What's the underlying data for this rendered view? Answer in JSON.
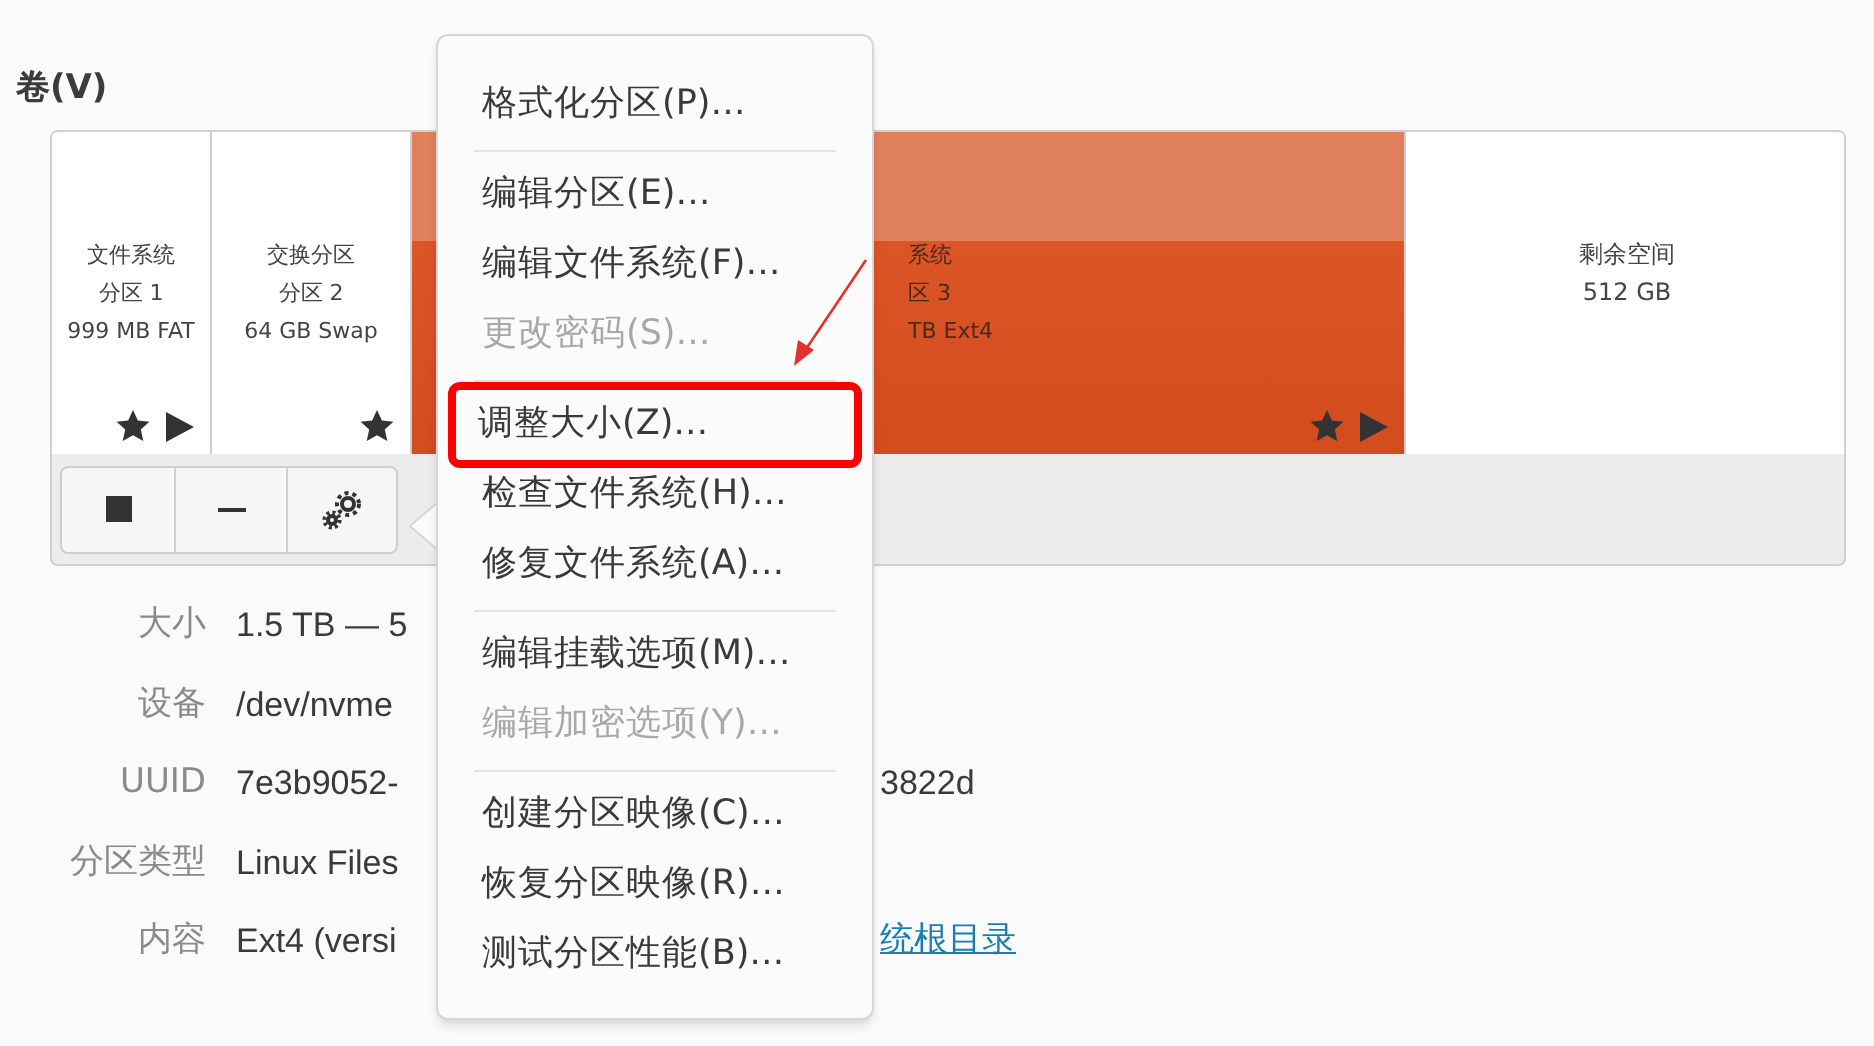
{
  "section_title": "卷(V)",
  "partitions": [
    {
      "lines": [
        "文件系统",
        "分区 1",
        "999 MB FAT"
      ],
      "kind": "used",
      "selected": false,
      "star": true,
      "play": true
    },
    {
      "lines": [
        "交换分区",
        "分区 2",
        "64 GB Swap"
      ],
      "kind": "used",
      "selected": false,
      "star": true,
      "play": false
    },
    {
      "lines": [
        "系统",
        "区 3",
        "TB Ext4"
      ],
      "kind": "used",
      "selected": true,
      "star": true,
      "play": true
    },
    {
      "lines": [
        "剩余空间",
        "512 GB"
      ],
      "kind": "free",
      "selected": false,
      "star": false,
      "play": false
    }
  ],
  "details": [
    {
      "label": "大小",
      "value": "1.5 TB — 5"
    },
    {
      "label": "设备",
      "value": "/dev/nvme"
    },
    {
      "label": "UUID",
      "value": "7e3b9052-",
      "value_tail": "3822d"
    },
    {
      "label": "分区类型",
      "value": "Linux Files"
    },
    {
      "label": "内容",
      "value": "Ext4 (versi",
      "link": "统根目录"
    }
  ],
  "menu": [
    [
      {
        "label": "格式化分区(P)…",
        "disabled": false,
        "highlighted": false
      }
    ],
    [
      {
        "label": "编辑分区(E)…",
        "disabled": false,
        "highlighted": false
      },
      {
        "label": "编辑文件系统(F)…",
        "disabled": false,
        "highlighted": false
      },
      {
        "label": "更改密码(S)…",
        "disabled": true,
        "highlighted": false
      }
    ],
    [
      {
        "label": "调整大小(Z)…",
        "disabled": false,
        "highlighted": true
      },
      {
        "label": "检查文件系统(H)…",
        "disabled": false,
        "highlighted": false
      },
      {
        "label": "修复文件系统(A)…",
        "disabled": false,
        "highlighted": false
      }
    ],
    [
      {
        "label": "编辑挂载选项(M)…",
        "disabled": false,
        "highlighted": false
      },
      {
        "label": "编辑加密选项(Y)…",
        "disabled": true,
        "highlighted": false
      }
    ],
    [
      {
        "label": "创建分区映像(C)…",
        "disabled": false,
        "highlighted": false
      },
      {
        "label": "恢复分区映像(R)…",
        "disabled": false,
        "highlighted": false
      },
      {
        "label": "测试分区性能(B)…",
        "disabled": false,
        "highlighted": false
      }
    ]
  ]
}
